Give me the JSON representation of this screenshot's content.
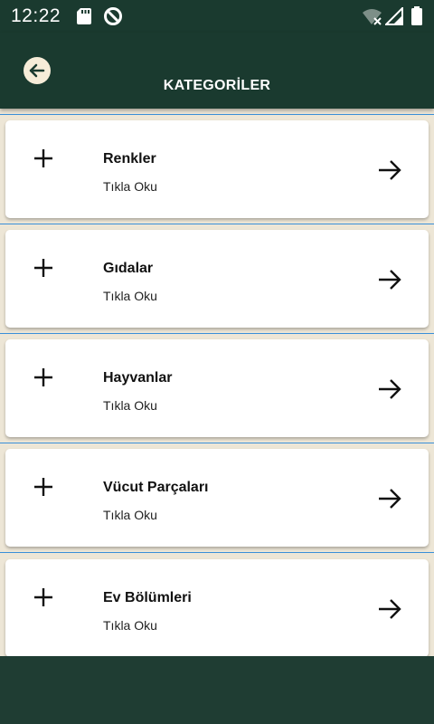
{
  "status_bar": {
    "time": "12:22",
    "icons": [
      "sd-card-icon",
      "data-saver-icon",
      "wifi-off-icon",
      "signal-icon",
      "battery-icon"
    ]
  },
  "app_bar": {
    "title": "KATEGORİLER",
    "back_icon": "arrow-back-icon"
  },
  "colors": {
    "app_bar_bg": "#1a3a2f",
    "list_bg": "#ede6d6",
    "card_bg": "#ffffff",
    "divider": "#3a8fd8",
    "back_button_bg": "#f6ecd8"
  },
  "categories": [
    {
      "title": "Renkler",
      "subtitle": "Tıkla Oku"
    },
    {
      "title": "Gıdalar",
      "subtitle": "Tıkla Oku"
    },
    {
      "title": "Hayvanlar",
      "subtitle": "Tıkla Oku"
    },
    {
      "title": "Vücut Parçaları",
      "subtitle": "Tıkla Oku"
    },
    {
      "title": "Ev Bölümleri",
      "subtitle": "Tıkla Oku"
    }
  ]
}
